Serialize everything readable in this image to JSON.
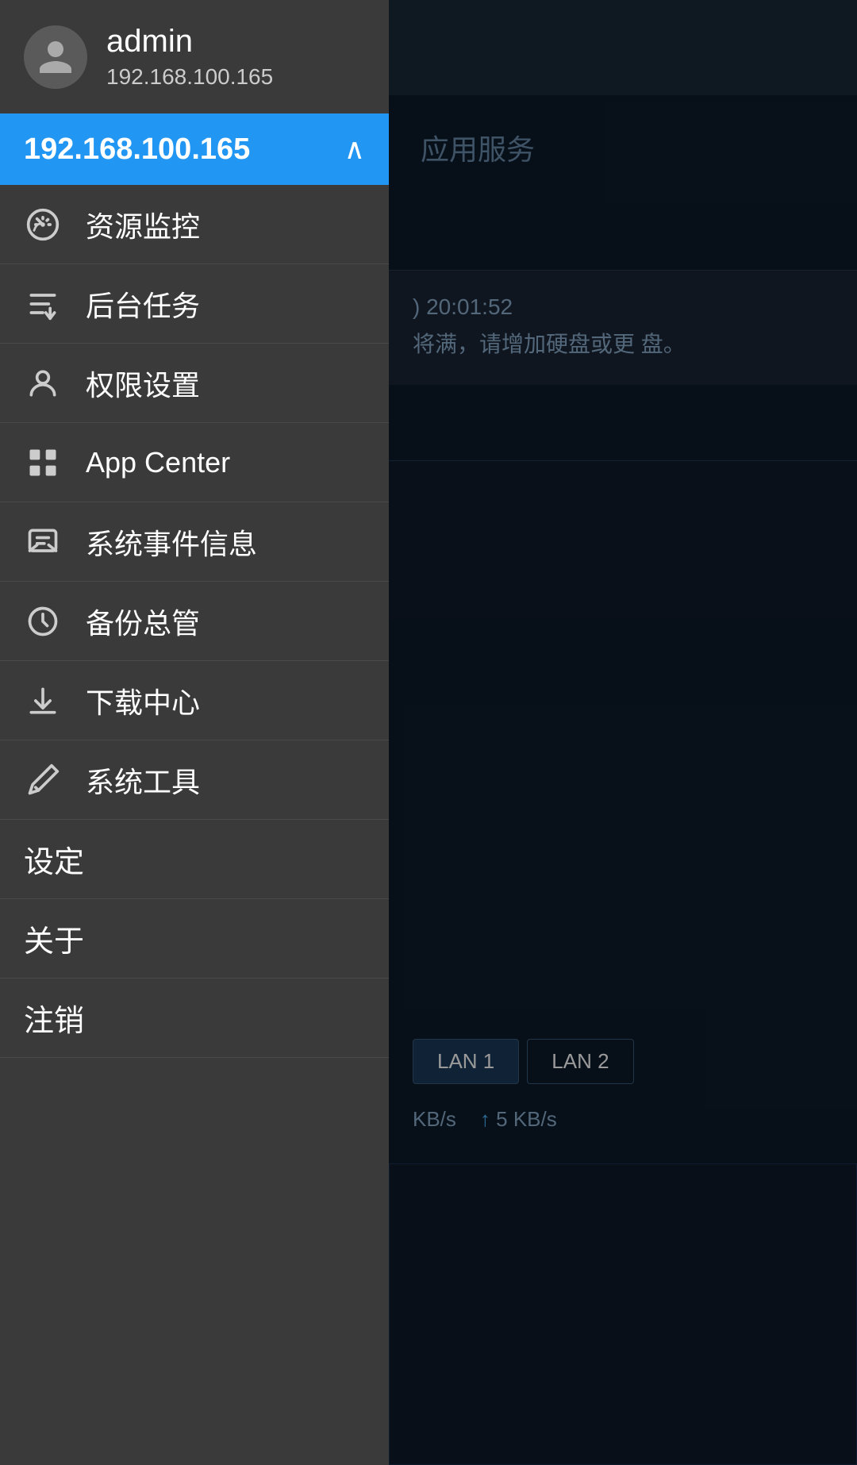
{
  "user": {
    "name": "admin",
    "ip": "192.168.100.165",
    "avatar_icon": "user-icon"
  },
  "ip_row": {
    "text": "192.168.100.165",
    "chevron": "chevron-up-icon",
    "chevron_char": "∧"
  },
  "background": {
    "app_services_label": "应用服务",
    "notification_time": ") 20:01:52",
    "notification_text": "将满，请增加硬盘或更\n盘。",
    "lan1_label": "LAN 1",
    "lan2_label": "LAN 2",
    "speed_down": "KB/s",
    "speed_up": "5 KB/s"
  },
  "menu": {
    "items": [
      {
        "id": "resource-monitor",
        "icon": "speedometer-icon",
        "label": "资源监控"
      },
      {
        "id": "background-tasks",
        "icon": "tasks-icon",
        "label": "后台任务"
      },
      {
        "id": "permissions",
        "icon": "person-icon",
        "label": "权限设置"
      },
      {
        "id": "app-center",
        "icon": "grid-icon",
        "label": "App Center"
      },
      {
        "id": "system-events",
        "icon": "message-icon",
        "label": "系统事件信息"
      },
      {
        "id": "backup",
        "icon": "backup-icon",
        "label": "备份总管"
      },
      {
        "id": "download-center",
        "icon": "download-icon",
        "label": "下载中心"
      },
      {
        "id": "system-tools",
        "icon": "tools-icon",
        "label": "系统工具"
      }
    ],
    "simple_items": [
      {
        "id": "settings",
        "label": "设定"
      },
      {
        "id": "about",
        "label": "关于"
      },
      {
        "id": "logout",
        "label": "注销"
      }
    ]
  }
}
